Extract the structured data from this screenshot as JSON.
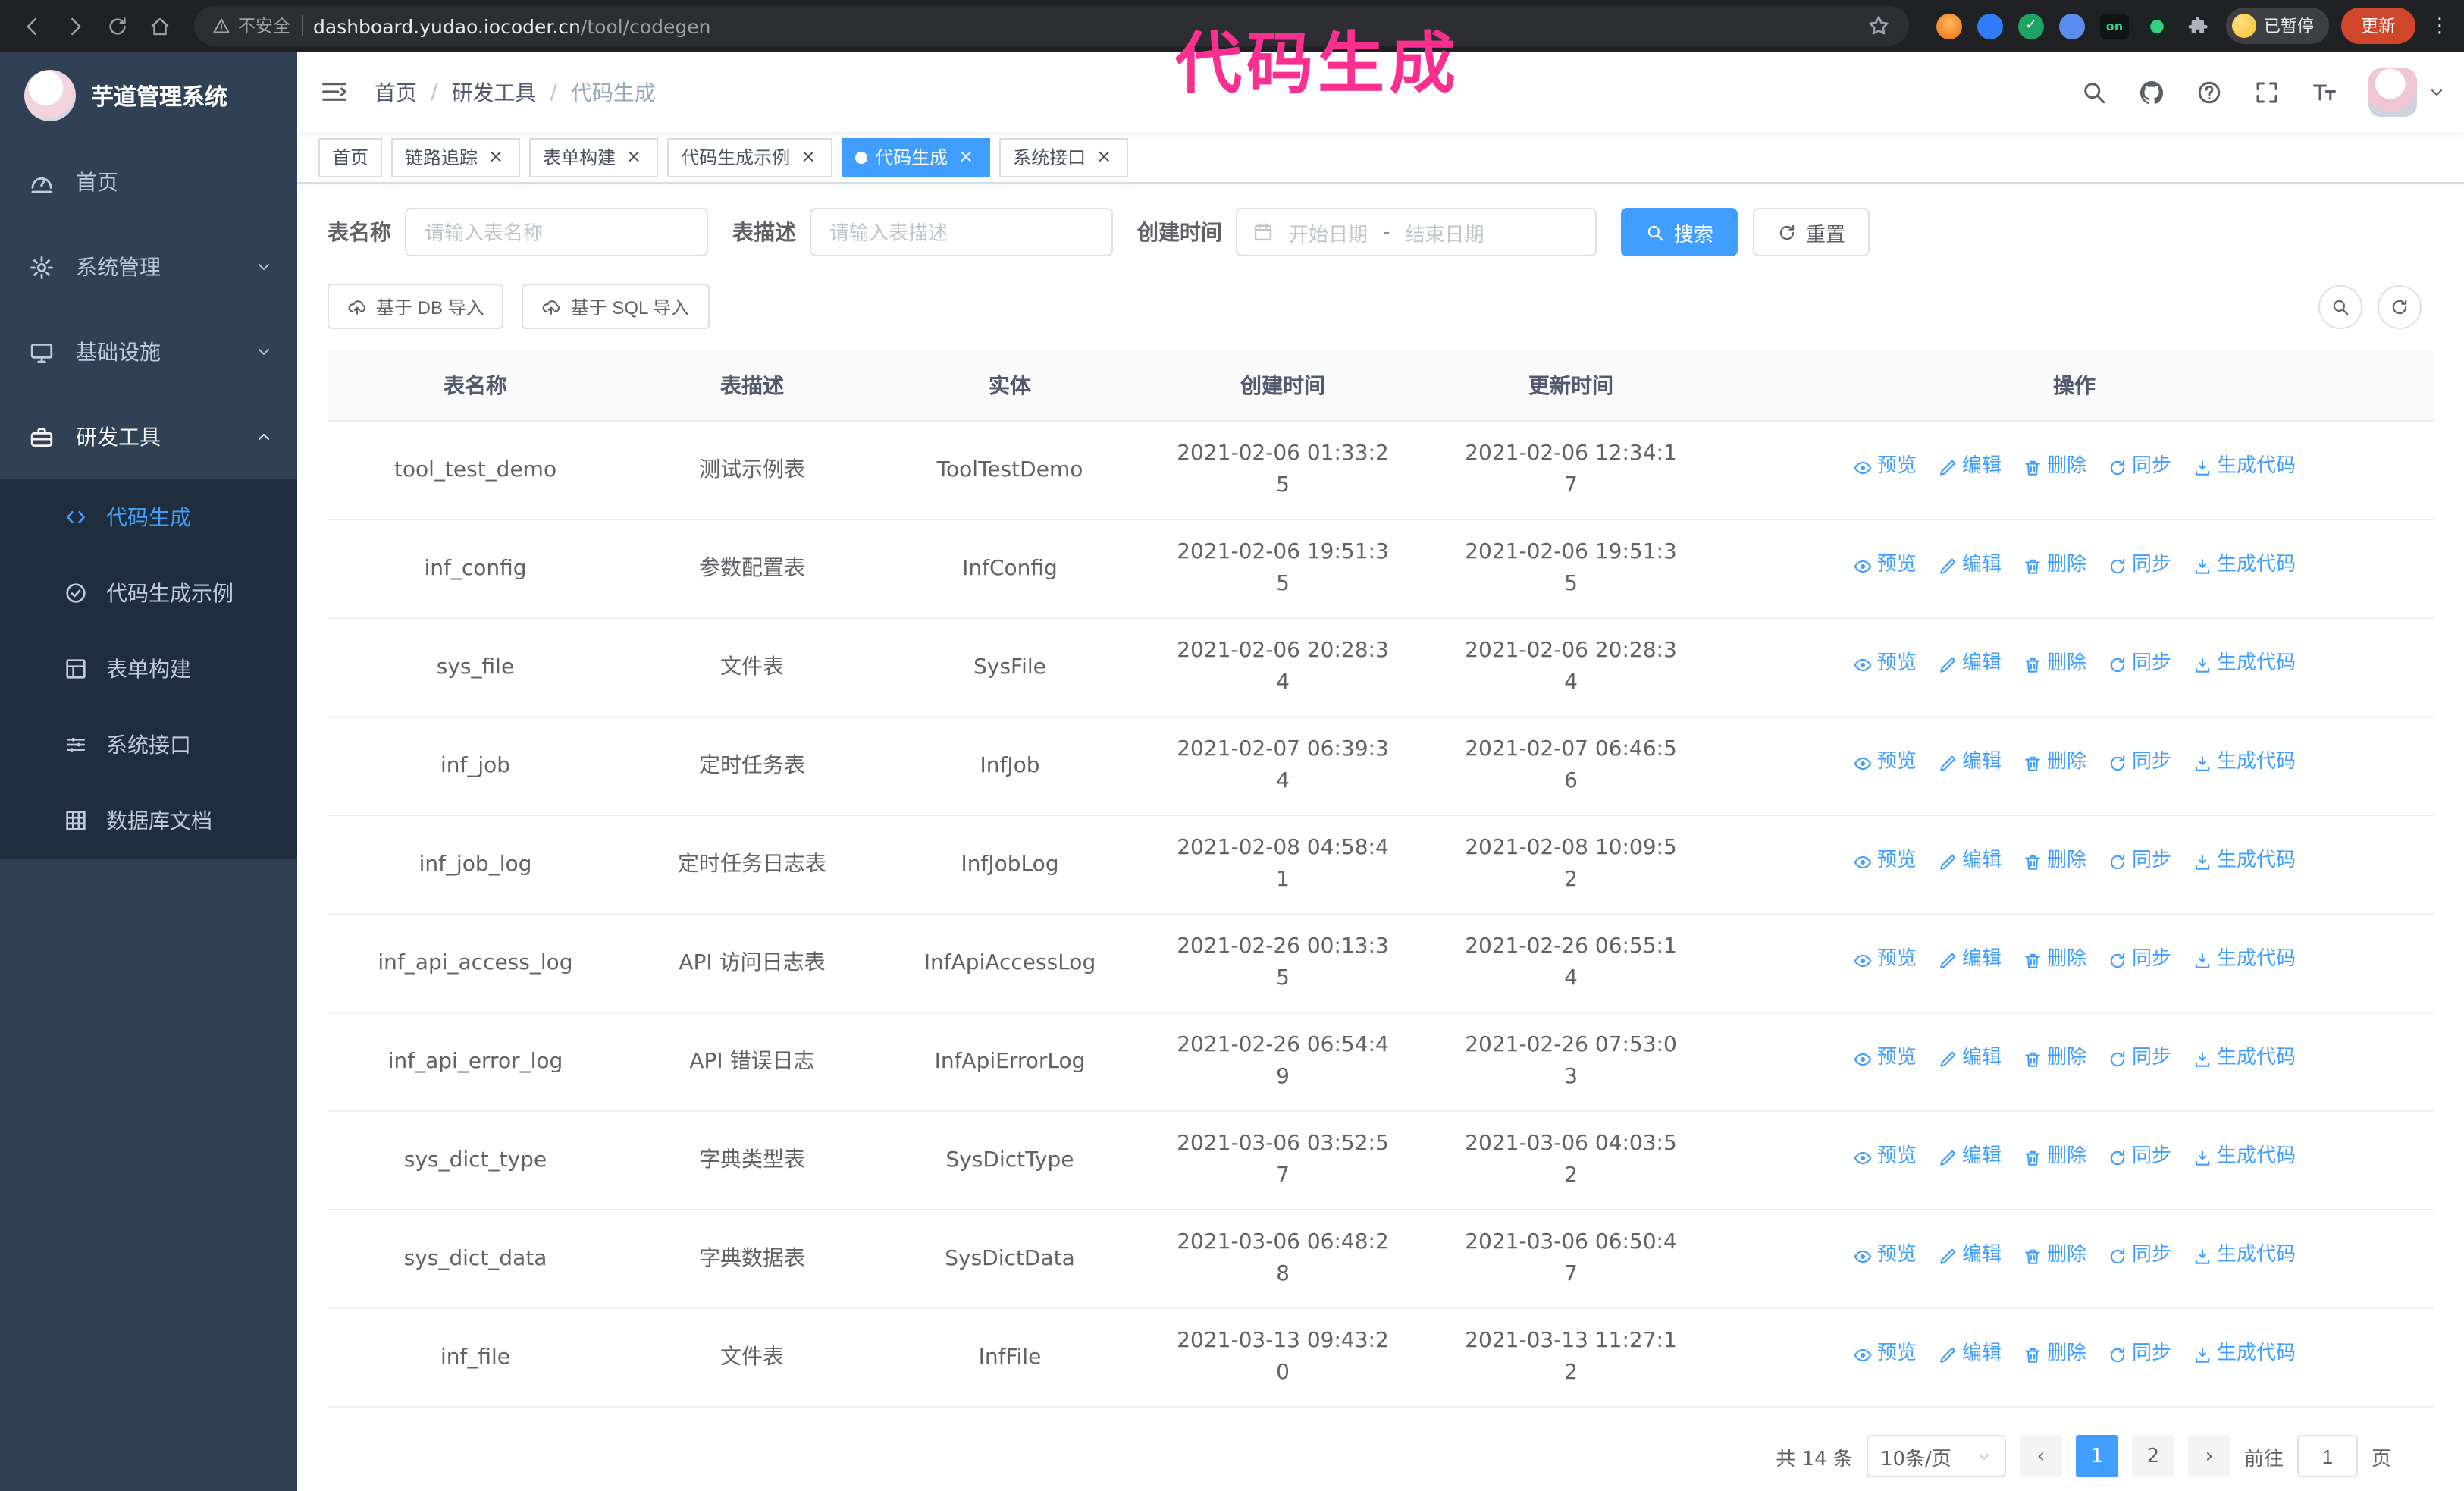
{
  "annotation": {
    "text": "代码生成"
  },
  "browser": {
    "security_text": "不安全",
    "url_domain": "dashboard.yudao.iocoder.cn",
    "url_path": "/tool/codegen",
    "ext_on_text": "on",
    "profile_badge": "已暂停",
    "update_button": "更新"
  },
  "sidebar": {
    "logo_title": "芋道管理系统",
    "items": [
      {
        "id": "home",
        "label": "首页",
        "icon": "dashboard-icon"
      },
      {
        "id": "system",
        "label": "系统管理",
        "icon": "gear-icon",
        "chevron": "down"
      },
      {
        "id": "infra",
        "label": "基础设施",
        "icon": "monitor-icon",
        "chevron": "down"
      },
      {
        "id": "devtools",
        "label": "研发工具",
        "icon": "toolbox-icon",
        "chevron": "up",
        "expanded": true,
        "children": [
          {
            "id": "codegen",
            "label": "代码生成",
            "icon": "code-icon",
            "active": true
          },
          {
            "id": "codegen-example",
            "label": "代码生成示例",
            "icon": "check-circle-icon"
          },
          {
            "id": "form-builder",
            "label": "表单构建",
            "icon": "form-icon"
          },
          {
            "id": "system-api",
            "label": "系统接口",
            "icon": "sliders-icon"
          },
          {
            "id": "db-doc",
            "label": "数据库文档",
            "icon": "grid-icon"
          }
        ]
      }
    ]
  },
  "breadcrumb": {
    "items": [
      "首页",
      "研发工具",
      "代码生成"
    ]
  },
  "tabs": [
    {
      "id": "home",
      "label": "首页",
      "closable": false,
      "active": false
    },
    {
      "id": "tracing",
      "label": "链路追踪",
      "closable": true,
      "active": false
    },
    {
      "id": "form-builder",
      "label": "表单构建",
      "closable": true,
      "active": false
    },
    {
      "id": "codegen-example",
      "label": "代码生成示例",
      "closable": true,
      "active": false
    },
    {
      "id": "codegen",
      "label": "代码生成",
      "closable": true,
      "active": true
    },
    {
      "id": "system-api",
      "label": "系统接口",
      "closable": true,
      "active": false
    }
  ],
  "filters": {
    "name_label": "表名称",
    "name_placeholder": "请输入表名称",
    "desc_label": "表描述",
    "desc_placeholder": "请输入表描述",
    "time_label": "创建时间",
    "date_start_placeholder": "开始日期",
    "date_separator": "-",
    "date_end_placeholder": "结束日期",
    "search_label": "搜索",
    "reset_label": "重置"
  },
  "toolbar": {
    "import_db": "基于 DB 导入",
    "import_sql": "基于 SQL 导入"
  },
  "table": {
    "headers": [
      "表名称",
      "表描述",
      "实体",
      "创建时间",
      "更新时间",
      "操作"
    ],
    "actions": [
      {
        "id": "preview",
        "label": "预览",
        "icon": "eye-icon"
      },
      {
        "id": "edit",
        "label": "编辑",
        "icon": "edit-icon"
      },
      {
        "id": "delete",
        "label": "删除",
        "icon": "trash-icon"
      },
      {
        "id": "sync",
        "label": "同步",
        "icon": "sync-icon"
      },
      {
        "id": "generate-code",
        "label": "生成代码",
        "icon": "download-icon"
      }
    ],
    "rows": [
      {
        "name": "tool_test_demo",
        "desc": "测试示例表",
        "entity": "ToolTestDemo",
        "created": "2021-02-06 01:33:25",
        "updated": "2021-02-06 12:34:17"
      },
      {
        "name": "inf_config",
        "desc": "参数配置表",
        "entity": "InfConfig",
        "created": "2021-02-06 19:51:35",
        "updated": "2021-02-06 19:51:35"
      },
      {
        "name": "sys_file",
        "desc": "文件表",
        "entity": "SysFile",
        "created": "2021-02-06 20:28:34",
        "updated": "2021-02-06 20:28:34"
      },
      {
        "name": "inf_job",
        "desc": "定时任务表",
        "entity": "InfJob",
        "created": "2021-02-07 06:39:34",
        "updated": "2021-02-07 06:46:56"
      },
      {
        "name": "inf_job_log",
        "desc": "定时任务日志表",
        "entity": "InfJobLog",
        "created": "2021-02-08 04:58:41",
        "updated": "2021-02-08 10:09:52"
      },
      {
        "name": "inf_api_access_log",
        "desc": "API 访问日志表",
        "entity": "InfApiAccessLog",
        "created": "2021-02-26 00:13:35",
        "updated": "2021-02-26 06:55:14"
      },
      {
        "name": "inf_api_error_log",
        "desc": "API 错误日志",
        "entity": "InfApiErrorLog",
        "created": "2021-02-26 06:54:49",
        "updated": "2021-02-26 07:53:03"
      },
      {
        "name": "sys_dict_type",
        "desc": "字典类型表",
        "entity": "SysDictType",
        "created": "2021-03-06 03:52:57",
        "updated": "2021-03-06 04:03:52"
      },
      {
        "name": "sys_dict_data",
        "desc": "字典数据表",
        "entity": "SysDictData",
        "created": "2021-03-06 06:48:28",
        "updated": "2021-03-06 06:50:47"
      },
      {
        "name": "inf_file",
        "desc": "文件表",
        "entity": "InfFile",
        "created": "2021-03-13 09:43:20",
        "updated": "2021-03-13 11:27:12"
      }
    ]
  },
  "pagination": {
    "total_text": "共 14 条",
    "page_size": "10条/页",
    "pages": [
      "1",
      "2"
    ],
    "active_page": "1",
    "goto_label": "前往",
    "goto_value": "1",
    "page_unit": "页"
  },
  "colors": {
    "accent": "#409eff",
    "annotation": "#fa2f8f",
    "sidebar_bg": "#304156",
    "submenu_bg": "#1f2d3d"
  }
}
